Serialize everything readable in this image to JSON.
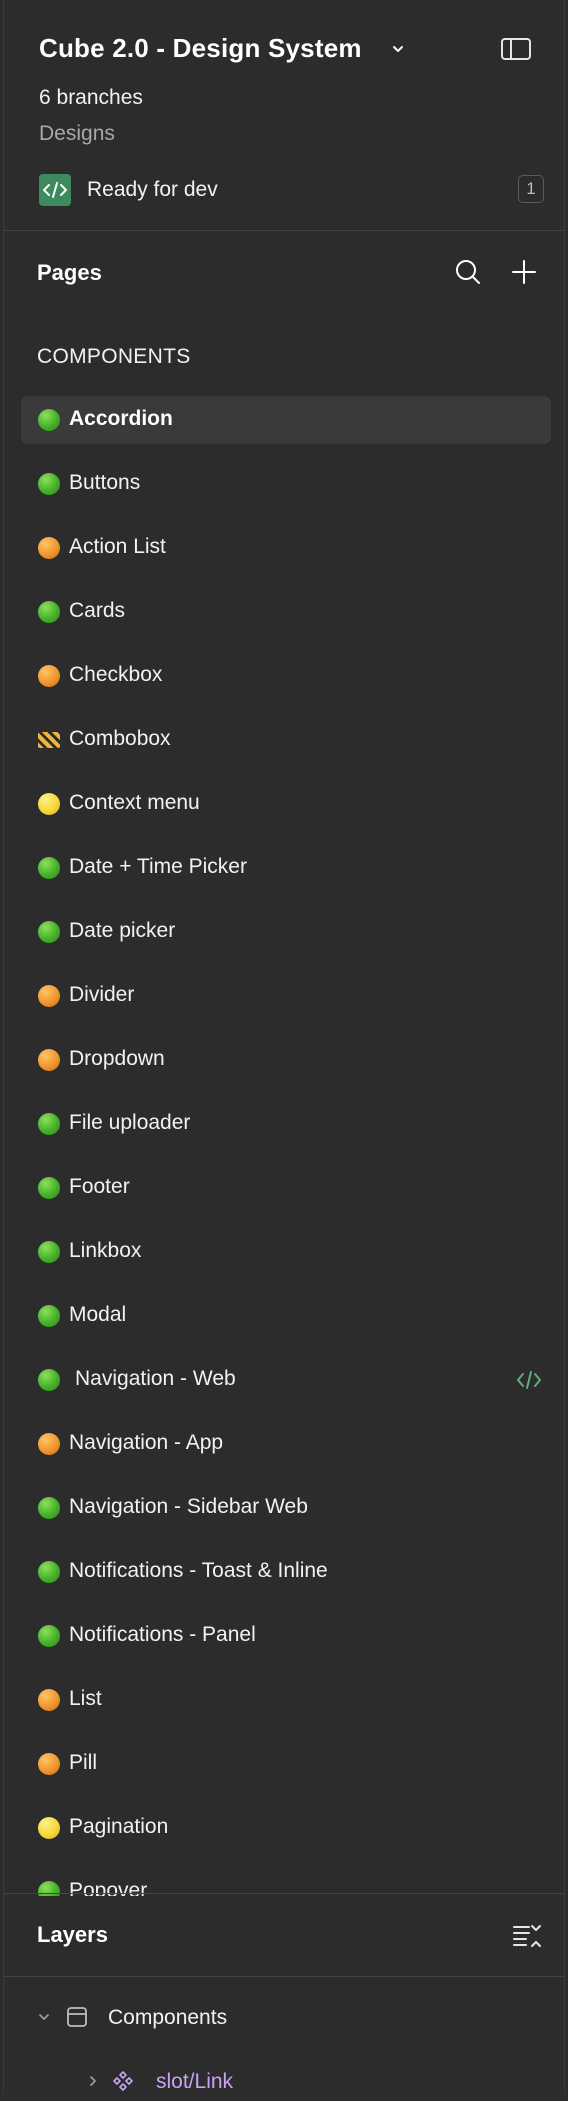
{
  "header": {
    "file_title": "Cube 2.0 - Design System",
    "branches": "6 branches",
    "project": "Designs",
    "status": {
      "label": "Ready for dev",
      "count": "1",
      "icon": "code-icon",
      "color": "#3c8a5d"
    }
  },
  "pages": {
    "heading": "Pages",
    "section": "COMPONENTS",
    "items": [
      {
        "label": "Accordion",
        "status": "green"
      },
      {
        "label": "Buttons",
        "status": "green"
      },
      {
        "label": "Action List",
        "status": "orange"
      },
      {
        "label": "Cards",
        "status": "green"
      },
      {
        "label": "Checkbox",
        "status": "orange"
      },
      {
        "label": "Combobox",
        "status": "barrier"
      },
      {
        "label": "Context menu",
        "status": "yellow"
      },
      {
        "label": "Date + Time Picker",
        "status": "green"
      },
      {
        "label": "Date picker",
        "status": "green"
      },
      {
        "label": "Divider",
        "status": "orange"
      },
      {
        "label": "Dropdown",
        "status": "orange"
      },
      {
        "label": "File uploader",
        "status": "green"
      },
      {
        "label": "Footer",
        "status": "green"
      },
      {
        "label": "Linkbox",
        "status": "green"
      },
      {
        "label": "Modal",
        "status": "green"
      },
      {
        "label": "Navigation - Web",
        "status": "green"
      },
      {
        "label": "Navigation - App",
        "status": "orange"
      },
      {
        "label": "Navigation - Sidebar Web",
        "status": "green"
      },
      {
        "label": "Notifications - Toast & Inline",
        "status": "green"
      },
      {
        "label": "Notifications - Panel",
        "status": "green"
      },
      {
        "label": "List",
        "status": "orange"
      },
      {
        "label": "Pill",
        "status": "orange"
      },
      {
        "label": "Pagination",
        "status": "yellow"
      },
      {
        "label": "Popover",
        "status": "green"
      }
    ]
  },
  "layers": {
    "heading": "Layers",
    "items": [
      {
        "name": "Components",
        "icon": "frame-icon",
        "color": "#ffffff"
      },
      {
        "name": "slot/Link",
        "icon": "component-icon",
        "color": "#c7a3f5"
      }
    ]
  },
  "colors": {
    "background": "#2c2c2c",
    "active_row": "#3a3a3a",
    "dev_green": "#3c8a5d",
    "component_purple": "#c7a3f5"
  }
}
